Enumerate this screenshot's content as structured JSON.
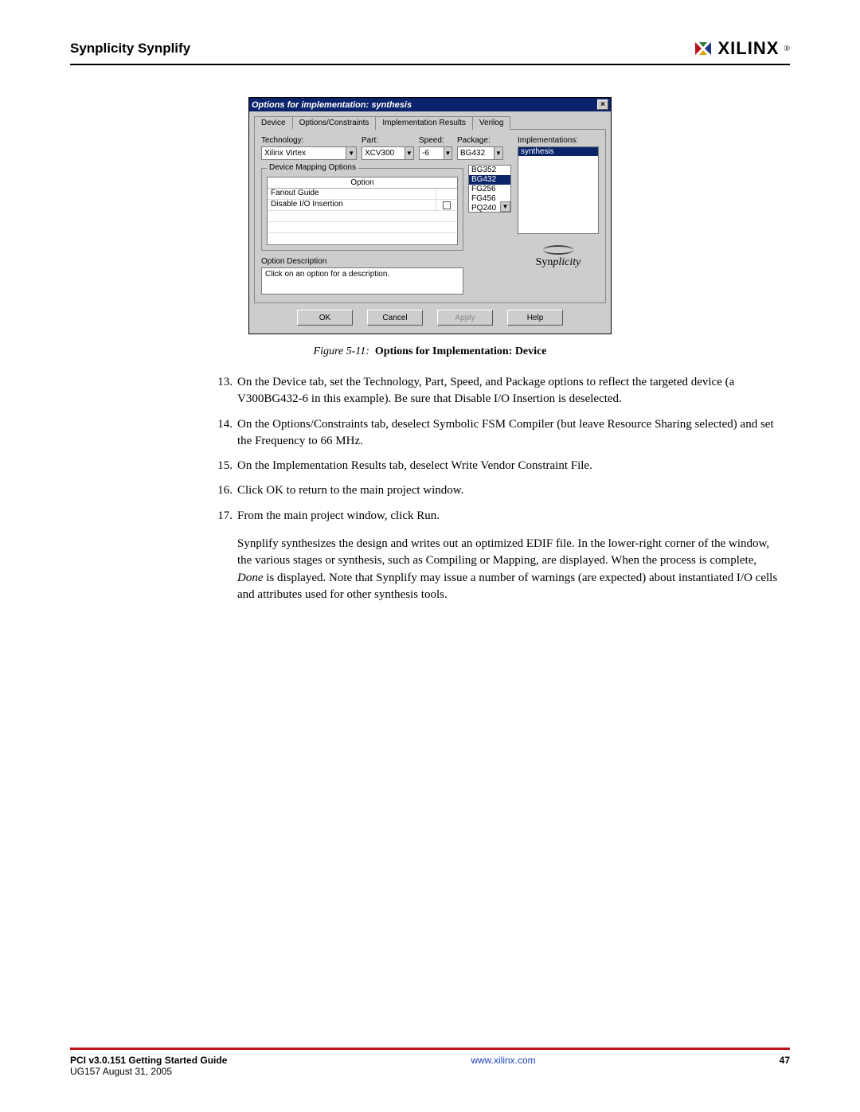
{
  "header": {
    "section": "Synplicity Synplify",
    "brand": "XILINX",
    "reg": "®"
  },
  "dialog": {
    "title": "Options for implementation: synthesis",
    "tabs": [
      "Device",
      "Options/Constraints",
      "Implementation Results",
      "Verilog"
    ],
    "labels": {
      "technology": "Technology:",
      "part": "Part:",
      "speed": "Speed:",
      "package": "Package:",
      "implementations": "Implementations:",
      "device_mapping": "Device Mapping Options",
      "option_col": "Option",
      "opt_desc_title": "Option Description",
      "opt_desc_text": "Click on an option for a description."
    },
    "values": {
      "technology": "Xilinx Virtex",
      "part": "XCV300",
      "speed": "-6",
      "package_selected": "BG432",
      "packages": [
        "BG352",
        "BG432",
        "FG256",
        "FG456",
        "PQ240"
      ],
      "implementation_selected": "synthesis"
    },
    "options_rows": [
      {
        "name": "Fanout Guide",
        "checked": false,
        "show_check": false
      },
      {
        "name": "Disable I/O Insertion",
        "checked": false,
        "show_check": true
      }
    ],
    "logo": {
      "prefix": "Syn",
      "suffix": "plicity"
    },
    "buttons": {
      "ok": "OK",
      "cancel": "Cancel",
      "apply": "Apply",
      "help": "Help"
    }
  },
  "caption": {
    "fig": "Figure 5-11:",
    "title": "Options for Implementation: Device"
  },
  "steps": {
    "s13": {
      "n": "13.",
      "t": "On the Device tab, set the Technology, Part, Speed, and Package options to reflect the targeted device (a V300BG432-6 in this example). Be sure that Disable I/O Insertion is deselected."
    },
    "s14": {
      "n": "14.",
      "t": "On the Options/Constraints tab, deselect Symbolic FSM Compiler (but leave Resource Sharing selected) and set the Frequency to 66 MHz."
    },
    "s15": {
      "n": "15.",
      "t": "On the Implementation Results tab, deselect Write Vendor Constraint File."
    },
    "s16": {
      "n": "16.",
      "t": "Click OK to return to the main project window."
    },
    "s17": {
      "n": "17.",
      "t": "From the main project window, click Run."
    },
    "s17p_a": "Synplify synthesizes the design and writes out an optimized EDIF file. In the lower-right corner of the window, the various stages or synthesis, such as Compiling or Mapping, are displayed. When the process is complete, ",
    "s17p_done": "Done",
    "s17p_b": " is displayed. Note that Synplify may issue a number of warnings (are expected) about instantiated I/O cells and attributes used for other synthesis tools."
  },
  "footer": {
    "title": "PCI v3.0.151 Getting Started Guide",
    "sub": "UG157 August 31, 2005",
    "link": "www.xilinx.com",
    "page": "47"
  }
}
